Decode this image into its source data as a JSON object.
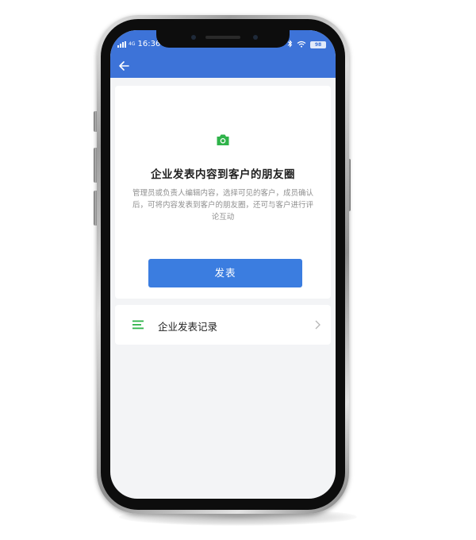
{
  "status_bar": {
    "network": "4G",
    "time": "16:36",
    "battery": "98"
  },
  "colors": {
    "primary": "#3d73d8",
    "button": "#3b7de0",
    "accent_green": "#2fb34a",
    "background": "#f3f4f6"
  },
  "icons": {
    "back": "arrow-left-icon",
    "camera": "camera-icon",
    "list": "list-icon",
    "chevron": "chevron-right-icon"
  },
  "hero": {
    "title": "企业发表内容到客户的朋友圈",
    "description": "管理员或负责人编辑内容，选择可见的客户，成员确认后，可将内容发表到客户的朋友圈，还可与客户进行评论互动",
    "publish_button": "发表"
  },
  "records": {
    "label": "企业发表记录"
  }
}
